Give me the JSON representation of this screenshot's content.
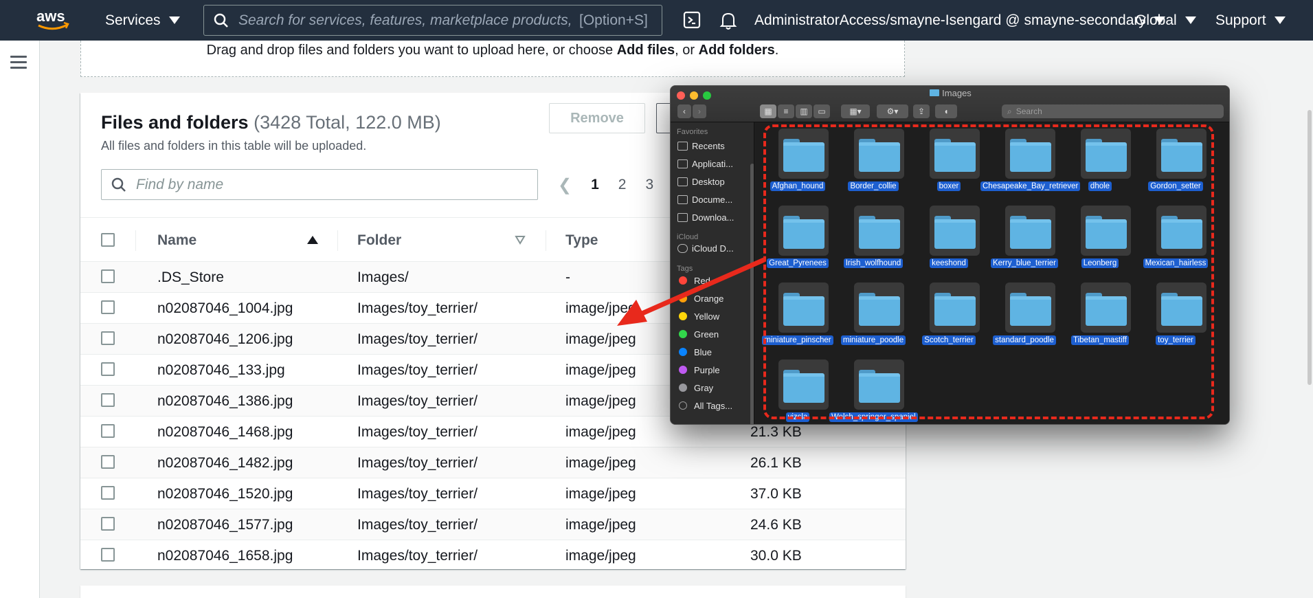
{
  "topnav": {
    "services": "Services",
    "search_placeholder": "Search for services, features, marketplace products, c",
    "search_shortcut": "[Option+S]",
    "account": "AdministratorAccess/smayne-Isengard @ smayne-secondary",
    "region": "Global",
    "support": "Support"
  },
  "dropzone": {
    "text_pre": "Drag and drop files and folders you want to upload here, or choose ",
    "add_files": "Add files",
    "comma": ", or ",
    "add_folders": "Add folders",
    "end": "."
  },
  "panel": {
    "title": "Files and folders",
    "count": "(3428 Total, 122.0 MB)",
    "description": "All files and folders in this table will be uploaded.",
    "remove_label": "Remove",
    "find_placeholder": "Find by name",
    "pages": [
      "1",
      "2",
      "3"
    ],
    "prev_symbol": "❮"
  },
  "table": {
    "headers": {
      "name": "Name",
      "folder": "Folder",
      "type": "Type"
    },
    "rows": [
      {
        "name": ".DS_Store",
        "folder": "Images/",
        "type": "-",
        "size": ""
      },
      {
        "name": "n02087046_1004.jpg",
        "folder": "Images/toy_terrier/",
        "type": "image/jpeg",
        "size": ""
      },
      {
        "name": "n02087046_1206.jpg",
        "folder": "Images/toy_terrier/",
        "type": "image/jpeg",
        "size": ""
      },
      {
        "name": "n02087046_133.jpg",
        "folder": "Images/toy_terrier/",
        "type": "image/jpeg",
        "size": ""
      },
      {
        "name": "n02087046_1386.jpg",
        "folder": "Images/toy_terrier/",
        "type": "image/jpeg",
        "size": ""
      },
      {
        "name": "n02087046_1468.jpg",
        "folder": "Images/toy_terrier/",
        "type": "image/jpeg",
        "size": "21.3 KB"
      },
      {
        "name": "n02087046_1482.jpg",
        "folder": "Images/toy_terrier/",
        "type": "image/jpeg",
        "size": "26.1 KB"
      },
      {
        "name": "n02087046_1520.jpg",
        "folder": "Images/toy_terrier/",
        "type": "image/jpeg",
        "size": "37.0 KB"
      },
      {
        "name": "n02087046_1577.jpg",
        "folder": "Images/toy_terrier/",
        "type": "image/jpeg",
        "size": "24.6 KB"
      },
      {
        "name": "n02087046_1658.jpg",
        "folder": "Images/toy_terrier/",
        "type": "image/jpeg",
        "size": "30.0 KB"
      }
    ]
  },
  "finder": {
    "title": "Images",
    "search_placeholder": "Search",
    "favorites_header": "Favorites",
    "favorites": [
      "Recents",
      "Applicati...",
      "Desktop",
      "Docume...",
      "Downloa..."
    ],
    "icloud_header": "iCloud",
    "icloud": [
      "iCloud D..."
    ],
    "tags_header": "Tags",
    "tags": [
      {
        "label": "Red",
        "color": "#ff453a"
      },
      {
        "label": "Orange",
        "color": "#ff9f0a"
      },
      {
        "label": "Yellow",
        "color": "#ffd60a"
      },
      {
        "label": "Green",
        "color": "#32d74b"
      },
      {
        "label": "Blue",
        "color": "#0a84ff"
      },
      {
        "label": "Purple",
        "color": "#bf5af2"
      },
      {
        "label": "Gray",
        "color": "#98989d"
      },
      {
        "label": "All Tags...",
        "color": ""
      }
    ],
    "folders": [
      "Afghan_hound",
      "Border_collie",
      "boxer",
      "Chesapeake_Bay_retriever",
      "dhole",
      "Gordon_setter",
      "Great_Pyrenees",
      "Irish_wolfhound",
      "keeshond",
      "Kerry_blue_terrier",
      "Leonberg",
      "Mexican_hairless",
      "miniature_pinscher",
      "miniature_poodle",
      "Scotch_terrier",
      "standard_poodle",
      "Tibetan_mastiff",
      "toy_terrier",
      "vizsla",
      "Welsh_springer_spaniel"
    ]
  },
  "colors": {
    "nav_bg": "#232f3e",
    "annotation_red": "#e8291c",
    "selection_blue": "#1d5fd0"
  }
}
